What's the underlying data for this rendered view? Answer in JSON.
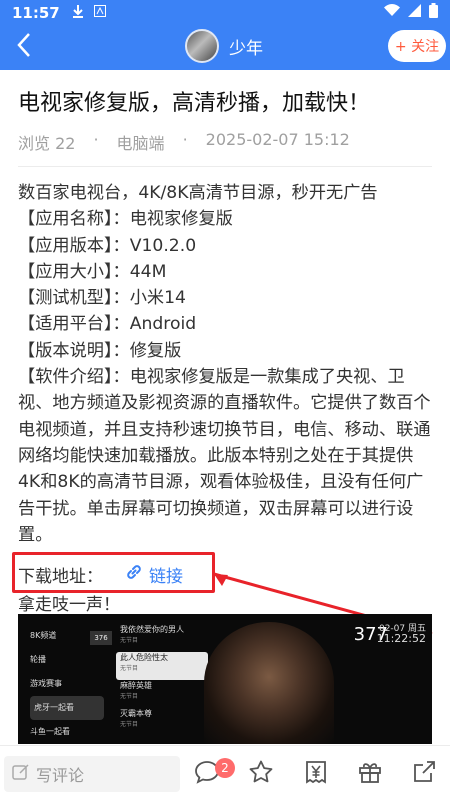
{
  "status_bar": {
    "time": "11:57",
    "icons": [
      "download-icon",
      "notification-icon",
      "wifi-icon",
      "signal-icon",
      "battery-icon"
    ]
  },
  "header": {
    "author_name": "少年",
    "follow_label": "+ 关注"
  },
  "post": {
    "title": "电视家修复版，高清秒播，加载快！",
    "views": "浏览 22",
    "platform": "电脑端",
    "datetime": "2025-02-07 15:12",
    "paragraphs": [
      "数百家电视台，4K/8K高清节目源，秒开无广告",
      "【应用名称】：电视家修复版",
      "【应用版本】：V10.2.0",
      "【应用大小】：44M",
      "【测试机型】：小米14",
      "【适用平台】：Android",
      "【版本说明】：修复版",
      "【软件介绍】：电视家修复版是一款集成了央视、卫视、地方频道及影视资源的直播软件。它提供了数百个电视频道，并且支持秒速切换节目，电信、移动、联通网络均能快速加载播放。此版本特别之处在于其提供4K和8K的高清节目源，观看体验极佳，且没有任何广告干扰。单击屏幕可切换频道，双击屏幕可以进行设置。"
    ],
    "download_label": "下载地址：",
    "link_label": "链接",
    "after_text": "拿走吱一声！"
  },
  "video": {
    "menu": [
      "8K频道",
      "轮播",
      "游戏赛事",
      "虎牙一起看",
      "斗鱼一起看"
    ],
    "channel_box": "376",
    "shows": [
      {
        "title": "我依然爱你的男人",
        "sub": "无节目"
      },
      {
        "title": "此人危险性太",
        "sub": "无节目"
      },
      {
        "title": "麻醉英雄",
        "sub": "无节目"
      },
      {
        "title": "灭霸本尊",
        "sub": "无节目"
      }
    ],
    "channel_number": "377",
    "date": "02-07 周五",
    "clock": "11:22:52"
  },
  "bottom_bar": {
    "comment_placeholder": "写评论",
    "comment_count": "2",
    "icons": [
      "comment-bubble-icon",
      "star-icon",
      "reward-icon",
      "gift-icon",
      "share-icon"
    ]
  },
  "colors": {
    "accent": "#3b82f6",
    "follow_text": "#ff5a3c",
    "annotation_red": "#e8232a",
    "badge": "#ff6b6b"
  }
}
